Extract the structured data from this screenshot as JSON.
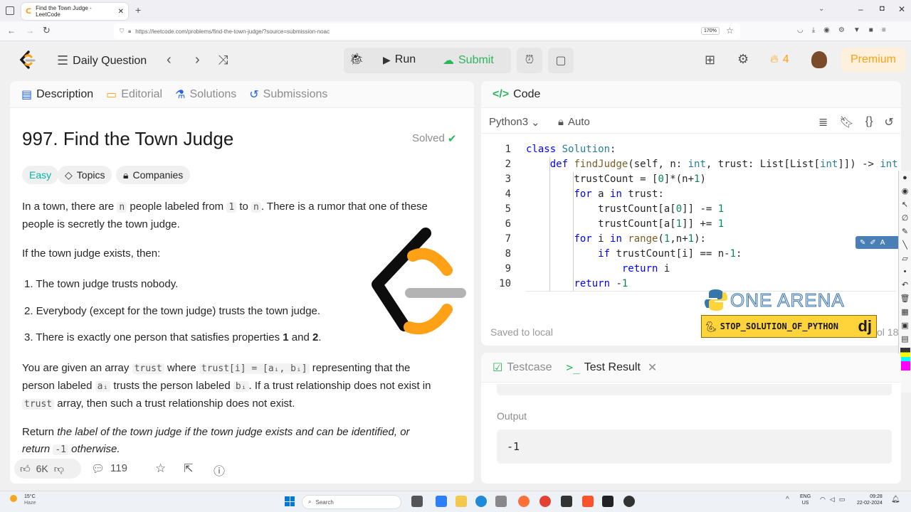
{
  "browser": {
    "tab_title": "Find the Town Judge - LeetCode",
    "url": "https://leetcode.com/problems/find-the-town-judge/?source=submission-noac",
    "zoom": "170%"
  },
  "topbar": {
    "daily_question": "Daily Question",
    "run": "Run",
    "submit": "Submit",
    "streak_count": "4",
    "premium": "Premium"
  },
  "left": {
    "tabs": [
      "Description",
      "Editorial",
      "Solutions",
      "Submissions"
    ],
    "title": "997. Find the Town Judge",
    "solved": "Solved",
    "tags": [
      "Easy",
      "Topics",
      "Companies"
    ],
    "p1": {
      "a": "In a town, there are ",
      "n": "n",
      "b": " people labeled from ",
      "one": "1",
      "c": " to ",
      "n2": "n",
      "d": ". There is a rumor that one of these",
      "e": "people is secretly the town judge."
    },
    "p2": "If the town judge exists, then:",
    "list": [
      "1. The town judge trusts nobody.",
      "2. Everybody (except for the town judge) trusts the town judge.",
      "3. There is exactly one person that satisfies properties "
    ],
    "list_bold1": "1",
    "list_and": " and ",
    "list_bold2": "2",
    "list_end": ".",
    "p3": {
      "a": "You are given an array ",
      "trust": "trust",
      "b": " where ",
      "chip": "trust[i] = [aᵢ, bᵢ]",
      "c": " representing that the",
      "d": "person labeled ",
      "ai": "aᵢ",
      "e": " trusts the person labeled ",
      "bi": "bᵢ",
      "f": ". If a trust relationship does not exist in",
      "trust2": "trust",
      "g": " array, then such a trust relationship does not exist."
    },
    "p4": {
      "a": "Return ",
      "italic": "the label of the town judge if the town judge exists and can be identified, or",
      "b": "return ",
      "chip": "-1",
      "c": " otherwise."
    },
    "footer": {
      "likes": "6K",
      "comments": "119"
    }
  },
  "code": {
    "header": "Code",
    "language": "Python3",
    "mode": "Auto",
    "lines": [
      {
        "n": "1",
        "text": "class Solution:"
      },
      {
        "n": "2",
        "text": "    def findJudge(self, n: int, trust: List[List[int]]) -> int:"
      },
      {
        "n": "3",
        "text": "        trustCount = [0]*(n+1)"
      },
      {
        "n": "4",
        "text": "        for a in trust:"
      },
      {
        "n": "5",
        "text": "            trustCount[a[0]] -= 1"
      },
      {
        "n": "6",
        "text": "            trustCount[a[1]] += 1"
      },
      {
        "n": "7",
        "text": "        for i in range(1,n+1):"
      },
      {
        "n": "8",
        "text": "            if trustCount[i] == n-1:"
      },
      {
        "n": "9",
        "text": "                return i"
      },
      {
        "n": "10",
        "text": "        return -1"
      }
    ],
    "saved": "Saved to local",
    "col": "ol 18"
  },
  "watermark": {
    "brand": "ONE ARENA",
    "channel": "STOP_SOLUTION_OF_PYTHON",
    "suffix": "dj"
  },
  "result": {
    "tabs": [
      "Testcase",
      "Test Result"
    ],
    "output_label": "Output",
    "output_value": "-1"
  },
  "taskbar": {
    "weather_temp": "15°C",
    "weather_desc": "Haze",
    "search": "Search",
    "lang": "ENG",
    "region": "US",
    "time": "09:28",
    "date": "22-02-2024"
  },
  "colors": {
    "accent_orange": "#ffa116",
    "submit_green": "#2db55d",
    "easy_teal": "#00b8a3"
  }
}
